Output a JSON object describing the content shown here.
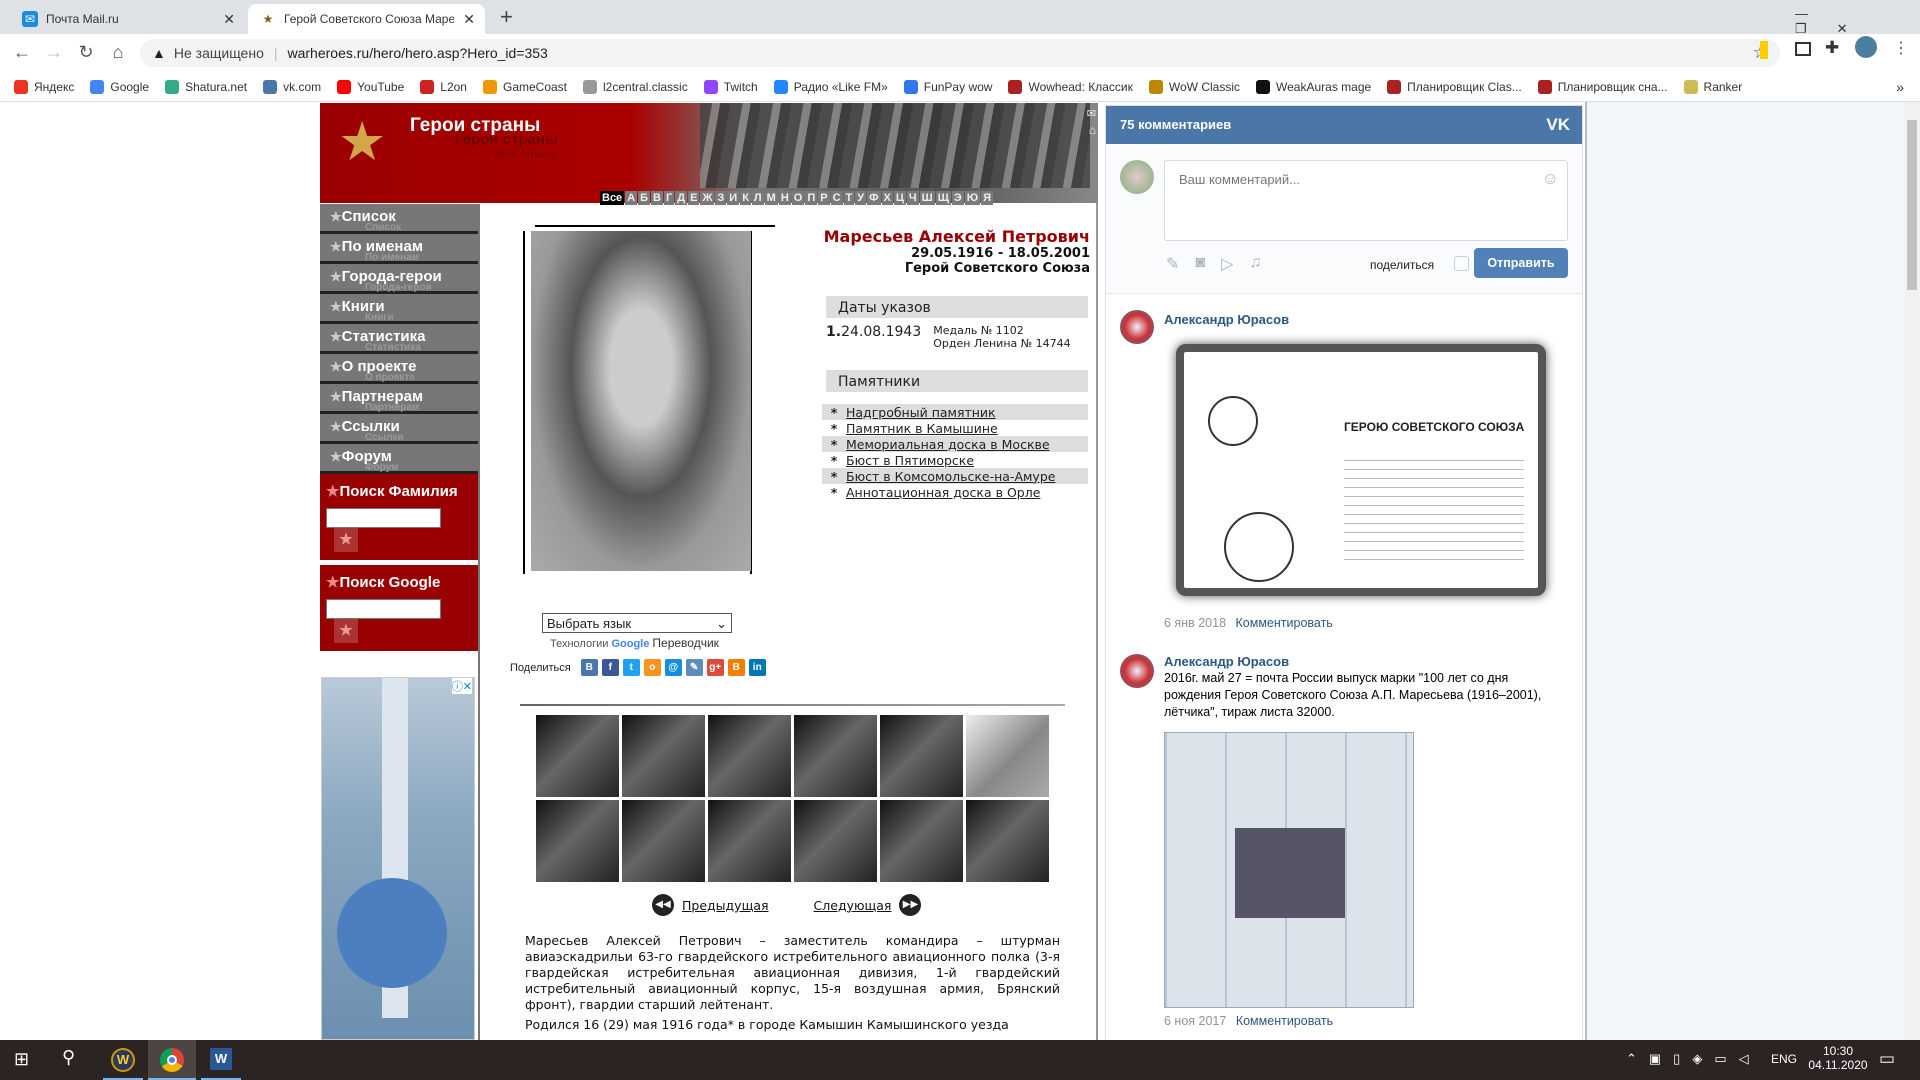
{
  "browser": {
    "tabs": [
      {
        "title": "Почта Mail.ru",
        "icon": "mail-icon"
      },
      {
        "title": "Герой Советского Союза Маресьев",
        "icon": "star-icon",
        "active": true
      }
    ],
    "new_tab": "+",
    "security": "Не защищено",
    "url": "warheroes.ru/hero/hero.asp?Hero_id=353",
    "bookmarks": [
      {
        "label": "Яндекс",
        "color": "#e32"
      },
      {
        "label": "Google",
        "color": "#4285f4"
      },
      {
        "label": "Shatura.net",
        "color": "#3a8"
      },
      {
        "label": "vk.com",
        "color": "#4a76a8"
      },
      {
        "label": "YouTube",
        "color": "#f00"
      },
      {
        "label": "L2on",
        "color": "#c22"
      },
      {
        "label": "GameCoast",
        "color": "#e90"
      },
      {
        "label": "l2central.classic",
        "color": "#999"
      },
      {
        "label": "Twitch",
        "color": "#9146ff"
      },
      {
        "label": "Радио «Like FM»",
        "color": "#28f"
      },
      {
        "label": "FunPay wow",
        "color": "#37e"
      },
      {
        "label": "Wowhead: Классик",
        "color": "#a22"
      },
      {
        "label": "WoW Classic",
        "color": "#b80"
      },
      {
        "label": "WeakAuras mage",
        "color": "#111"
      },
      {
        "label": "Планировщик Clas...",
        "color": "#a22"
      },
      {
        "label": "Планировщик сна...",
        "color": "#a22"
      },
      {
        "label": "Ranker",
        "color": "#cb5"
      }
    ],
    "more": "»"
  },
  "site": {
    "title": "Герои страны",
    "alphabet": [
      "Все",
      "А",
      "Б",
      "В",
      "Г",
      "Д",
      "Е",
      "Ж",
      "З",
      "И",
      "К",
      "Л",
      "М",
      "Н",
      "О",
      "П",
      "Р",
      "С",
      "Т",
      "У",
      "Ф",
      "Х",
      "Ц",
      "Ч",
      "Ш",
      "Щ",
      "Э",
      "Ю",
      "Я"
    ],
    "menu": [
      "Список",
      "По именам",
      "Города-герои",
      "Книги",
      "Статистика",
      "О проекте",
      "Партнерам",
      "Ссылки",
      "Форум"
    ],
    "search_surname": "Поиск Фамилия",
    "search_google": "Поиск Google",
    "hero": {
      "name": "Маресьев Алексей Петрович",
      "dates": "29.05.1916 - 18.05.2001",
      "title": "Герой Советского Союза"
    },
    "decrees_header": "Даты указов",
    "decree": {
      "num": "1.",
      "date": "24.08.1943",
      "medal": "Медаль № 1102",
      "order": "Орден Ленина № 14744"
    },
    "monuments_header": "Памятники",
    "monuments": [
      "Надгробный памятник",
      "Памятник в Камышине",
      "Мемориальная доска в Москве",
      "Бюст в Пятиморске",
      "Бюст в Комсомольске-на-Амуре",
      "Аннотационная доска в Орле"
    ],
    "language_select": "Выбрать язык",
    "translate_prefix": "Технологии",
    "translate_google": "Google",
    "translate_suffix": "Переводчик",
    "share_label": "Поделиться",
    "share_icons": [
      {
        "name": "vk",
        "color": "#4a76a8",
        "glyph": "В"
      },
      {
        "name": "facebook",
        "color": "#3b5998",
        "glyph": "f"
      },
      {
        "name": "twitter",
        "color": "#1da1f2",
        "glyph": "t"
      },
      {
        "name": "odnoklassniki",
        "color": "#f7931e",
        "glyph": "о"
      },
      {
        "name": "mailru",
        "color": "#168de2",
        "glyph": "@"
      },
      {
        "name": "livejournal",
        "color": "#5c8cbf",
        "glyph": "✎"
      },
      {
        "name": "googleplus",
        "color": "#dd4b39",
        "glyph": "g+"
      },
      {
        "name": "blogger",
        "color": "#f57d00",
        "glyph": "B"
      },
      {
        "name": "linkedin",
        "color": "#0077b5",
        "glyph": "in"
      }
    ],
    "prev": "Предыдущая",
    "next": "Следующая",
    "bio": [
      "Маресьев Алексей Петрович – заместитель командира – штурман авиаэскадрильи 63-го гвардейского истребительного авиационного полка (3-я гвардейская истребительная авиационная дивизия, 1-й гвардейский истребительный авиационный корпус, 15-я воздушная армия, Брянский фронт), гвардии старший лейтенант.",
      "Родился 16 (29) мая 1916 года* в городе Камышин Камышинского уезда"
    ]
  },
  "vk": {
    "count": "75 комментариев",
    "logo": "VK",
    "placeholder": "Ваш комментарий...",
    "share": "поделиться",
    "send": "Отправить",
    "comments": [
      {
        "author": "Александр Юрасов",
        "text": "",
        "image_caption": "ГЕРОЮ СОВЕТСКОГО СОЮЗА",
        "date": "6 янв 2018",
        "reply": "Комментировать"
      },
      {
        "author": "Александр Юрасов",
        "text": "2016г. май 27 = почта России выпуск марки \"100 лет со дня рождения Героя Советского Союза А.П. Маресьева (1916–2001), лётчика\", тираж листа 32000.",
        "date": "6 ноя 2017",
        "reply": "Комментировать"
      }
    ]
  },
  "taskbar": {
    "lang": "ENG",
    "time": "10:30",
    "date": "04.11.2020"
  }
}
